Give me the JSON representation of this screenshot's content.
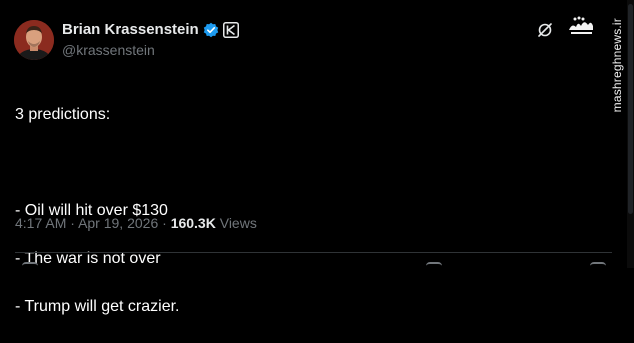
{
  "author": {
    "display_name": "Brian Krassenstein",
    "handle": "@krassenstein",
    "avatar_icon": "profile-photo",
    "verified_icon": "verified-badge-icon",
    "affiliate_icon": "affiliate-badge-icon"
  },
  "tweet": {
    "lines": [
      "3 predictions:",
      "",
      "- Oil will hit over $130",
      "- The war is not over",
      "- Trump will get crazier."
    ]
  },
  "meta": {
    "time": "4:17 AM",
    "separator": "·",
    "date": "Apr 19, 2026",
    "separator2": "·",
    "views_count": "160.3K",
    "views_label": "Views"
  },
  "watermark": {
    "logo_text": "مشرق",
    "url": "mashreghnews.ir"
  },
  "colors": {
    "background": "#000000",
    "text_primary": "#e7e9ea",
    "text_secondary": "#71767b",
    "verified_blue": "#1d9bf0",
    "divider": "#2f3336"
  }
}
